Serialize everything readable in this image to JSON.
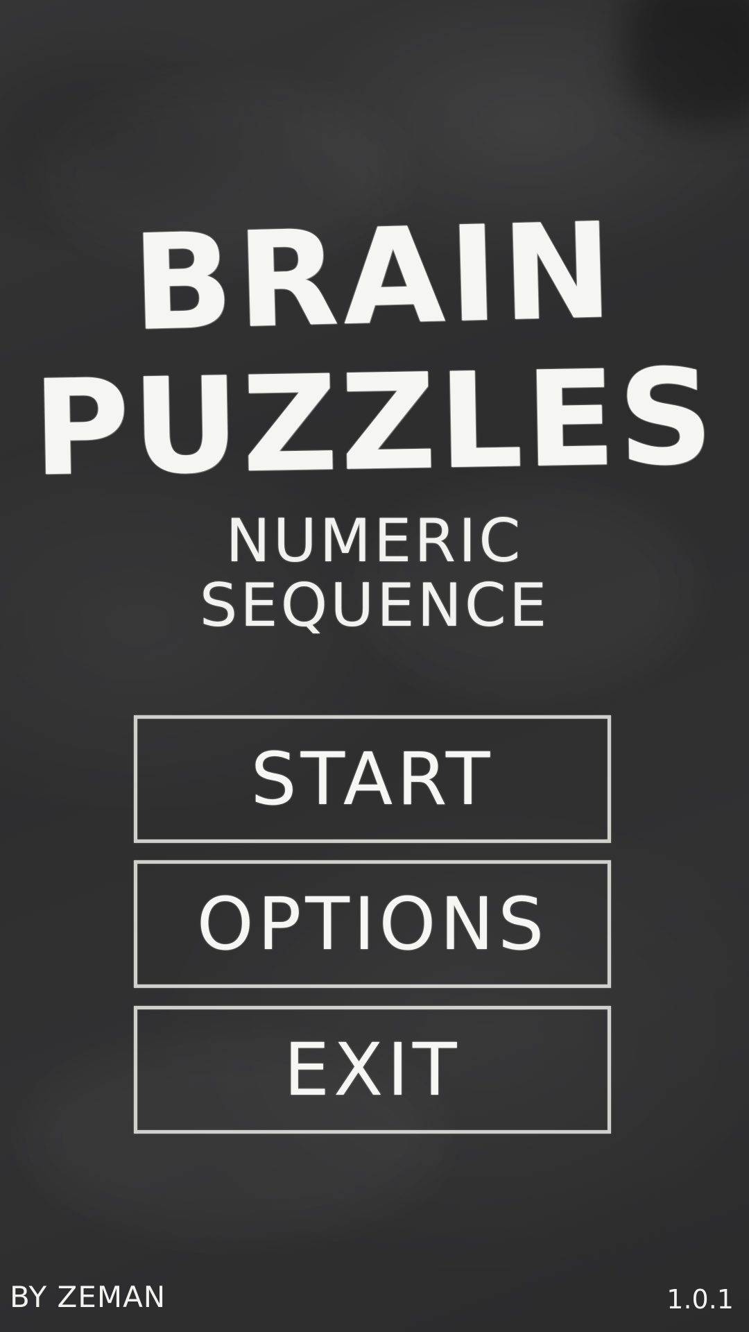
{
  "game": {
    "title_line1": "BRAIN",
    "title_line2": "PUZZLES",
    "subtitle_line1": "NUMERIC",
    "subtitle_line2": "SEQUENCE"
  },
  "menu": {
    "start_label": "START",
    "options_label": "OPTIONS",
    "exit_label": "EXIT"
  },
  "footer": {
    "author": "BY ZEMAN",
    "version": "1.0.1"
  },
  "colors": {
    "chalkboard": "#2e2e2f",
    "chalk": "#f4f4f2"
  }
}
